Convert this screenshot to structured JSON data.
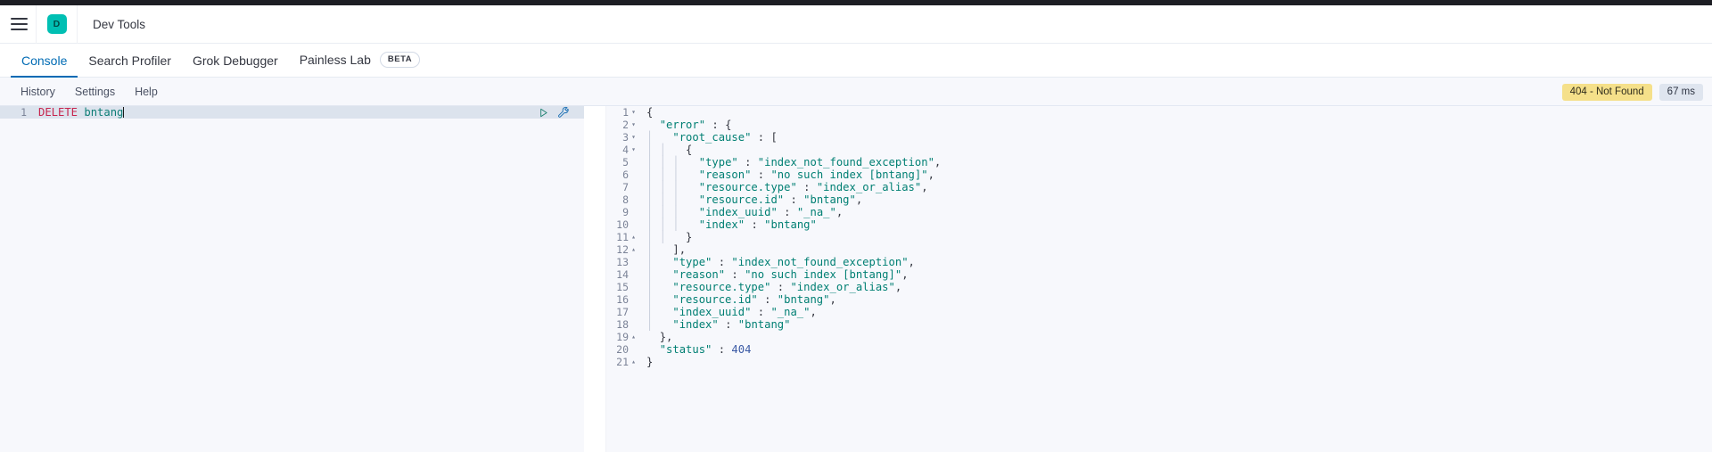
{
  "header": {
    "menu_icon": "hamburger-menu-icon",
    "logo_text": "D",
    "title": "Dev Tools"
  },
  "tabs": [
    {
      "label": "Console",
      "active": true
    },
    {
      "label": "Search Profiler",
      "active": false
    },
    {
      "label": "Grok Debugger",
      "active": false
    },
    {
      "label": "Painless Lab",
      "active": false,
      "badge": "BETA"
    }
  ],
  "console_toolbar": {
    "buttons": [
      "History",
      "Settings",
      "Help"
    ],
    "status_badge": "404 - Not Found",
    "time_badge": "67 ms"
  },
  "editor": {
    "line_number": "1",
    "method": "DELETE",
    "target": "bntang",
    "play_icon": "play-triangle-icon",
    "wrench_icon": "wrench-icon"
  },
  "response": {
    "lines": [
      {
        "n": "1",
        "fold": "down",
        "indent": 0,
        "guides": 0,
        "text": "{"
      },
      {
        "n": "2",
        "fold": "down",
        "indent": 1,
        "guides": 0,
        "text": "\"error\" : {"
      },
      {
        "n": "3",
        "fold": "down",
        "indent": 2,
        "guides": 1,
        "text": "\"root_cause\" : ["
      },
      {
        "n": "4",
        "fold": "down",
        "indent": 3,
        "guides": 2,
        "text": "{"
      },
      {
        "n": "5",
        "fold": "",
        "indent": 4,
        "guides": 3,
        "text": "\"type\" : \"index_not_found_exception\","
      },
      {
        "n": "6",
        "fold": "",
        "indent": 4,
        "guides": 3,
        "text": "\"reason\" : \"no such index [bntang]\","
      },
      {
        "n": "7",
        "fold": "",
        "indent": 4,
        "guides": 3,
        "text": "\"resource.type\" : \"index_or_alias\","
      },
      {
        "n": "8",
        "fold": "",
        "indent": 4,
        "guides": 3,
        "text": "\"resource.id\" : \"bntang\","
      },
      {
        "n": "9",
        "fold": "",
        "indent": 4,
        "guides": 3,
        "text": "\"index_uuid\" : \"_na_\","
      },
      {
        "n": "10",
        "fold": "",
        "indent": 4,
        "guides": 3,
        "text": "\"index\" : \"bntang\""
      },
      {
        "n": "11",
        "fold": "up",
        "indent": 3,
        "guides": 2,
        "text": "}"
      },
      {
        "n": "12",
        "fold": "up",
        "indent": 2,
        "guides": 1,
        "text": "],"
      },
      {
        "n": "13",
        "fold": "",
        "indent": 2,
        "guides": 1,
        "text": "\"type\" : \"index_not_found_exception\","
      },
      {
        "n": "14",
        "fold": "",
        "indent": 2,
        "guides": 1,
        "text": "\"reason\" : \"no such index [bntang]\","
      },
      {
        "n": "15",
        "fold": "",
        "indent": 2,
        "guides": 1,
        "text": "\"resource.type\" : \"index_or_alias\","
      },
      {
        "n": "16",
        "fold": "",
        "indent": 2,
        "guides": 1,
        "text": "\"resource.id\" : \"bntang\","
      },
      {
        "n": "17",
        "fold": "",
        "indent": 2,
        "guides": 1,
        "text": "\"index_uuid\" : \"_na_\","
      },
      {
        "n": "18",
        "fold": "",
        "indent": 2,
        "guides": 1,
        "text": "\"index\" : \"bntang\""
      },
      {
        "n": "19",
        "fold": "up",
        "indent": 1,
        "guides": 0,
        "text": "},"
      },
      {
        "n": "20",
        "fold": "",
        "indent": 1,
        "guides": 0,
        "text": "\"status\" : 404"
      },
      {
        "n": "21",
        "fold": "up",
        "indent": 0,
        "guides": 0,
        "text": "}"
      }
    ]
  },
  "colors": {
    "accent": "#006bb4",
    "logo": "#00bfb3",
    "status_warning": "#f5e08a",
    "json_string": "#007f73",
    "method_keyword": "#c7254e",
    "url_token": "#0d7d76"
  }
}
